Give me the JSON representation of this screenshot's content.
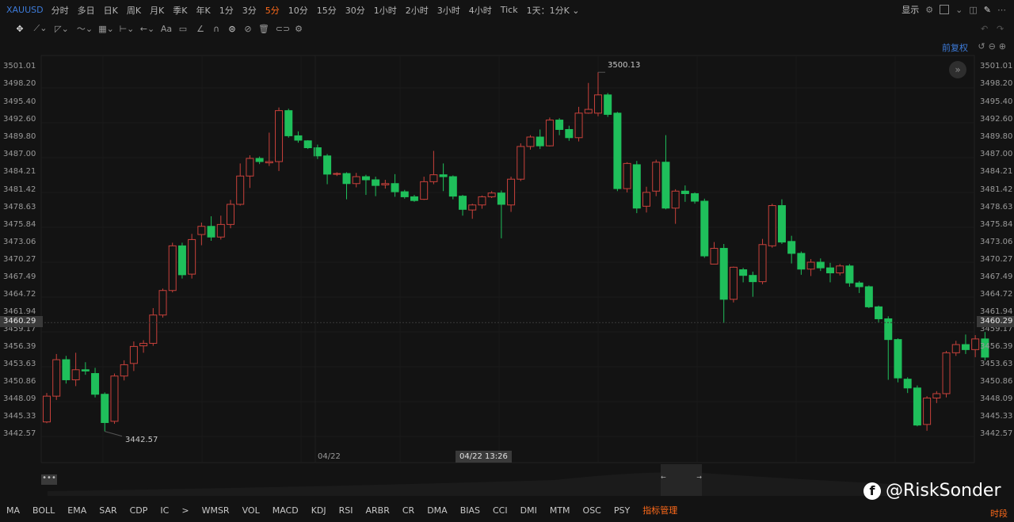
{
  "header": {
    "symbol": "XAUUSD",
    "periods": [
      "分时",
      "多日",
      "日K",
      "周K",
      "月K",
      "季K",
      "年K",
      "1分",
      "3分",
      "5分",
      "10分",
      "15分",
      "30分",
      "1小时",
      "2小时",
      "3小时",
      "4小时",
      "Tick",
      "1天：1分K"
    ],
    "active_period": "5分",
    "display_label": "显示"
  },
  "price_panel": {
    "adjust_label": "前复权",
    "current_price": "3460.29",
    "max_label": "3500.13",
    "min_label": "3442.57",
    "x_label_date": "04/22",
    "crosshair_label": "04/22 13:26"
  },
  "chart_data": {
    "type": "candlestick",
    "ylim": [
      3441.2,
      3502.4
    ],
    "y_ticks": [
      "3501.01",
      "3498.20",
      "3495.40",
      "3492.60",
      "3489.80",
      "3487.00",
      "3484.21",
      "3481.42",
      "3478.63",
      "3475.84",
      "3473.06",
      "3470.27",
      "3467.49",
      "3464.72",
      "3461.94",
      "3459.17",
      "3456.39",
      "3453.63",
      "3450.86",
      "3448.09",
      "3445.33",
      "3442.57"
    ],
    "candles": [
      [
        3444.5,
        3448.6,
        3444.3,
        3449.1
      ],
      [
        3448.6,
        3454.4,
        3448.0,
        3455.3
      ],
      [
        3454.4,
        3451.2,
        3450.6,
        3455.0
      ],
      [
        3451.2,
        3452.8,
        3450.2,
        3455.5
      ],
      [
        3452.8,
        3452.6,
        3452.0,
        3454.0
      ],
      [
        3452.2,
        3448.9,
        3448.4,
        3453.1
      ],
      [
        3448.9,
        3444.4,
        3443.0,
        3449.2
      ],
      [
        3444.6,
        3451.8,
        3444.2,
        3452.2
      ],
      [
        3451.8,
        3453.6,
        3451.1,
        3454.3
      ],
      [
        3453.8,
        3456.5,
        3452.6,
        3457.3
      ],
      [
        3456.6,
        3457.0,
        3455.5,
        3457.5
      ],
      [
        3457.0,
        3461.5,
        3456.6,
        3462.6
      ],
      [
        3461.5,
        3465.4,
        3461.1,
        3465.7
      ],
      [
        3465.4,
        3472.5,
        3465.1,
        3473.0
      ],
      [
        3472.5,
        3467.9,
        3467.3,
        3473.0
      ],
      [
        3468.0,
        3473.5,
        3467.3,
        3474.4
      ],
      [
        3474.3,
        3475.6,
        3472.6,
        3476.2
      ],
      [
        3475.6,
        3473.9,
        3473.3,
        3477.2
      ],
      [
        3473.9,
        3475.9,
        3473.5,
        3477.3
      ],
      [
        3475.9,
        3479.1,
        3475.3,
        3479.8
      ],
      [
        3479.1,
        3483.6,
        3478.9,
        3485.6
      ],
      [
        3483.6,
        3486.4,
        3481.7,
        3486.9
      ],
      [
        3486.4,
        3485.9,
        3485.5,
        3486.7
      ],
      [
        3485.7,
        3485.9,
        3485.2,
        3490.5
      ],
      [
        3485.9,
        3494.0,
        3484.4,
        3494.5
      ],
      [
        3494.0,
        3490.0,
        3489.7,
        3494.3
      ],
      [
        3490.0,
        3489.3,
        3488.9,
        3490.7
      ],
      [
        3489.2,
        3488.1,
        3487.9,
        3489.3
      ],
      [
        3488.1,
        3486.8,
        3486.3,
        3488.6
      ],
      [
        3486.8,
        3483.9,
        3482.3,
        3487.1
      ],
      [
        3483.9,
        3484.0,
        3483.6,
        3484.2
      ],
      [
        3484.0,
        3482.4,
        3479.9,
        3484.2
      ],
      [
        3482.4,
        3483.5,
        3481.8,
        3484.1
      ],
      [
        3483.5,
        3483.0,
        3480.6,
        3483.8
      ],
      [
        3483.0,
        3482.1,
        3480.4,
        3483.5
      ],
      [
        3482.2,
        3482.4,
        3481.6,
        3483.0
      ],
      [
        3482.4,
        3481.1,
        3480.3,
        3483.9
      ],
      [
        3481.1,
        3480.3,
        3480.0,
        3481.4
      ],
      [
        3480.3,
        3479.7,
        3479.5,
        3480.6
      ],
      [
        3479.9,
        3482.7,
        3479.8,
        3483.5
      ],
      [
        3482.7,
        3483.8,
        3482.3,
        3487.6
      ],
      [
        3483.8,
        3483.5,
        3481.2,
        3485.6
      ],
      [
        3483.5,
        3480.4,
        3479.9,
        3483.7
      ],
      [
        3480.4,
        3478.3,
        3477.3,
        3480.6
      ],
      [
        3478.2,
        3479.0,
        3476.8,
        3479.2
      ],
      [
        3479.0,
        3480.3,
        3478.4,
        3480.5
      ],
      [
        3480.3,
        3480.9,
        3480.1,
        3481.2
      ],
      [
        3480.9,
        3479.1,
        3473.7,
        3481.3
      ],
      [
        3479.0,
        3483.1,
        3477.9,
        3483.5
      ],
      [
        3483.1,
        3488.3,
        3482.8,
        3488.8
      ],
      [
        3488.3,
        3489.8,
        3487.8,
        3490.1
      ],
      [
        3489.8,
        3488.4,
        3487.9,
        3491.0
      ],
      [
        3488.4,
        3492.5,
        3488.3,
        3492.9
      ],
      [
        3492.5,
        3491.0,
        3490.1,
        3492.8
      ],
      [
        3491.0,
        3489.7,
        3489.2,
        3491.6
      ],
      [
        3489.7,
        3493.6,
        3489.1,
        3494.6
      ],
      [
        3493.6,
        3494.2,
        3493.5,
        3498.4
      ],
      [
        3493.6,
        3496.5,
        3493.1,
        3500.1
      ],
      [
        3496.5,
        3493.4,
        3493.0,
        3496.8
      ],
      [
        3493.6,
        3481.6,
        3481.2,
        3493.8
      ],
      [
        3481.6,
        3485.6,
        3481.0,
        3485.8
      ],
      [
        3485.4,
        3478.5,
        3477.7,
        3486.0
      ],
      [
        3478.8,
        3481.0,
        3477.8,
        3481.9
      ],
      [
        3481.2,
        3485.8,
        3480.4,
        3486.2
      ],
      [
        3485.8,
        3478.5,
        3478.3,
        3490.1
      ],
      [
        3478.5,
        3481.2,
        3476.0,
        3481.5
      ],
      [
        3481.2,
        3480.8,
        3479.5,
        3482.1
      ],
      [
        3480.8,
        3479.6,
        3479.2,
        3481.0
      ],
      [
        3479.6,
        3470.9,
        3470.6,
        3480.0
      ],
      [
        3469.6,
        3472.1,
        3469.6,
        3473.1
      ],
      [
        3472.1,
        3464.0,
        3460.2,
        3472.8
      ],
      [
        3464.0,
        3469.1,
        3463.5,
        3469.2
      ],
      [
        3468.7,
        3467.8,
        3466.7,
        3469.0
      ],
      [
        3467.8,
        3466.8,
        3464.4,
        3468.4
      ],
      [
        3466.8,
        3472.7,
        3466.4,
        3473.6
      ],
      [
        3472.5,
        3478.9,
        3472.2,
        3479.2
      ],
      [
        3478.9,
        3473.1,
        3472.8,
        3479.9
      ],
      [
        3473.2,
        3471.3,
        3469.7,
        3474.1
      ],
      [
        3471.3,
        3468.8,
        3467.9,
        3471.6
      ],
      [
        3468.8,
        3469.9,
        3467.7,
        3470.4
      ],
      [
        3469.9,
        3469.0,
        3468.5,
        3470.5
      ],
      [
        3469.0,
        3468.2,
        3466.7,
        3469.8
      ],
      [
        3468.2,
        3469.3,
        3467.8,
        3469.6
      ],
      [
        3469.3,
        3466.6,
        3466.0,
        3469.6
      ],
      [
        3466.6,
        3466.0,
        3465.0,
        3466.9
      ],
      [
        3466.0,
        3462.8,
        3462.6,
        3466.2
      ],
      [
        3462.8,
        3460.9,
        3460.3,
        3463.0
      ],
      [
        3460.9,
        3457.6,
        3451.2,
        3461.3
      ],
      [
        3457.6,
        3451.5,
        3450.8,
        3457.8
      ],
      [
        3451.3,
        3449.9,
        3449.1,
        3451.6
      ],
      [
        3449.9,
        3444.0,
        3443.8,
        3450.3
      ],
      [
        3444.1,
        3448.3,
        3443.1,
        3448.6
      ],
      [
        3448.3,
        3449.0,
        3447.5,
        3449.4
      ],
      [
        3449.0,
        3455.5,
        3448.4,
        3455.8
      ],
      [
        3455.5,
        3456.8,
        3455.0,
        3457.4
      ],
      [
        3456.8,
        3456.0,
        3455.3,
        3458.4
      ],
      [
        3456.0,
        3457.7,
        3454.8,
        3458.3
      ],
      [
        3457.7,
        3454.8,
        3454.3,
        3458.8
      ]
    ]
  },
  "toolbar_bottom": {
    "indicators": [
      "MA",
      "BOLL",
      "EMA",
      "SAR",
      "CDP",
      "IC",
      "WMSR",
      "VOL",
      "MACD",
      "KDJ",
      "RSI",
      "ARBR",
      "CR",
      "DMA",
      "BIAS",
      "CCI",
      "DMI",
      "MTM",
      "OSC",
      "PSY"
    ],
    "more_label": ">",
    "manage_label": "指标管理",
    "right_label": "时段"
  },
  "watermark": {
    "text": "@RiskSonder",
    "icon": "facebook-icon"
  },
  "colors": {
    "up": "#c8413b",
    "down": "#1fbf5b",
    "bg": "#131313",
    "accent": "#ff6a1a",
    "link": "#3d7bd9"
  }
}
